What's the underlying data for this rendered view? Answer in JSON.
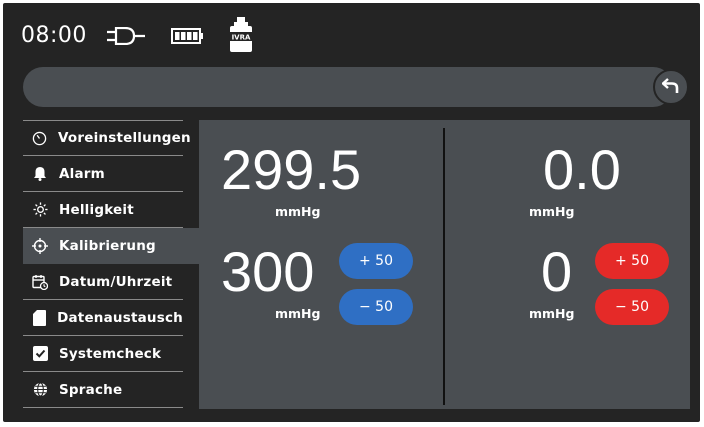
{
  "status": {
    "time": "08:00",
    "icons": [
      "power-plug-icon",
      "battery-icon",
      "ivra-device-icon"
    ],
    "device_label": "IVRA"
  },
  "navigation": {
    "back_icon": "back-arrow-icon"
  },
  "sidebar": {
    "items": [
      {
        "label": "Voreinstellungen",
        "icon": "gauge-icon",
        "active": false
      },
      {
        "label": "Alarm",
        "icon": "bell-icon",
        "active": false
      },
      {
        "label": "Helligkeit",
        "icon": "sun-icon",
        "active": false
      },
      {
        "label": "Kalibrierung",
        "icon": "crosshair-icon",
        "active": true
      },
      {
        "label": "Datum/Uhrzeit",
        "icon": "calendar-clock-icon",
        "active": false
      },
      {
        "label": "Datenaustausch",
        "icon": "sd-card-icon",
        "active": false
      },
      {
        "label": "Systemcheck",
        "icon": "checkbox-icon",
        "active": false
      },
      {
        "label": "Sprache",
        "icon": "globe-icon",
        "active": false
      }
    ]
  },
  "calibration": {
    "left": {
      "measured": "299.5",
      "measured_unit": "mmHg",
      "target": "300",
      "target_unit": "mmHg",
      "plus_label": "+ 50",
      "minus_label": "− 50",
      "button_color": "#2f6fc4"
    },
    "right": {
      "measured": "0.0",
      "measured_unit": "mmHg",
      "target": "0",
      "target_unit": "mmHg",
      "plus_label": "+ 50",
      "minus_label": "− 50",
      "button_color": "#e52a28"
    }
  },
  "colors": {
    "background": "#242424",
    "panel": "#4a4e52",
    "accent_blue": "#2f6fc4",
    "accent_red": "#e52a28"
  }
}
